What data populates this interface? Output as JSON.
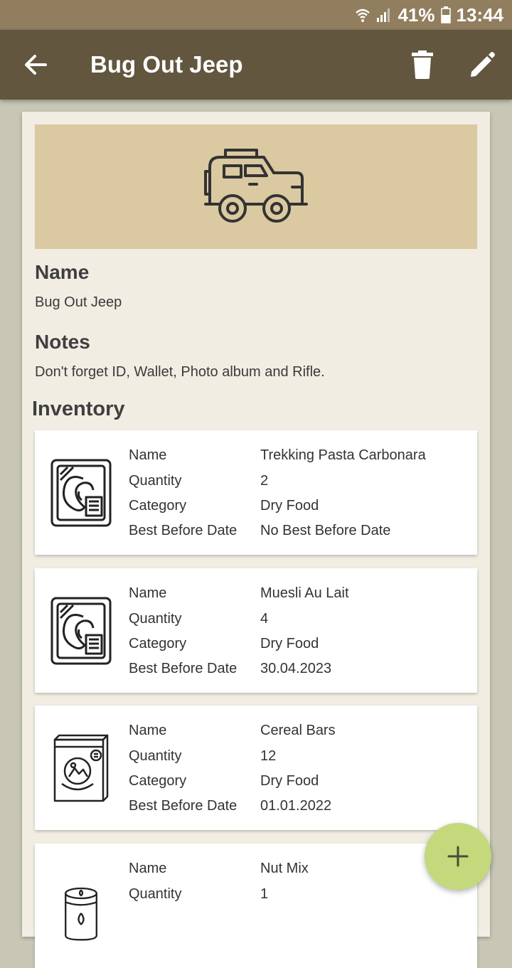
{
  "status_bar": {
    "battery": "41%",
    "time": "13:44"
  },
  "app_bar": {
    "title": "Bug Out Jeep"
  },
  "details": {
    "name_label": "Name",
    "name_value": "Bug Out Jeep",
    "notes_label": "Notes",
    "notes_value": "Don't forget ID, Wallet, Photo album and Rifle."
  },
  "inventory": {
    "title": "Inventory",
    "items": [
      {
        "icon": "canned-meat-icon",
        "name_label": "Name",
        "name": "Trekking Pasta Carbonara",
        "quantity_label": "Quantity",
        "quantity": "2",
        "category_label": "Category",
        "category": "Dry Food",
        "bbd_label": "Best Before Date",
        "bbd": "No Best Before Date"
      },
      {
        "icon": "canned-meat-icon",
        "name_label": "Name",
        "name": "Muesli Au Lait",
        "quantity_label": "Quantity",
        "quantity": "4",
        "category_label": "Category",
        "category": "Dry Food",
        "bbd_label": "Best Before Date",
        "bbd": "30.04.2023"
      },
      {
        "icon": "cereal-box-icon",
        "name_label": "Name",
        "name": "Cereal Bars",
        "quantity_label": "Quantity",
        "quantity": "12",
        "category_label": "Category",
        "category": "Dry Food",
        "bbd_label": "Best Before Date",
        "bbd": "01.01.2022"
      },
      {
        "icon": "can-icon",
        "name_label": "Name",
        "name": "Nut Mix",
        "quantity_label": "Quantity",
        "quantity": "1"
      }
    ]
  },
  "colors": {
    "status_bar": "#917e5f",
    "app_bar": "#62563f",
    "hero": "#dac9a1",
    "fab": "#c3d97b",
    "card": "#f2ede3"
  }
}
